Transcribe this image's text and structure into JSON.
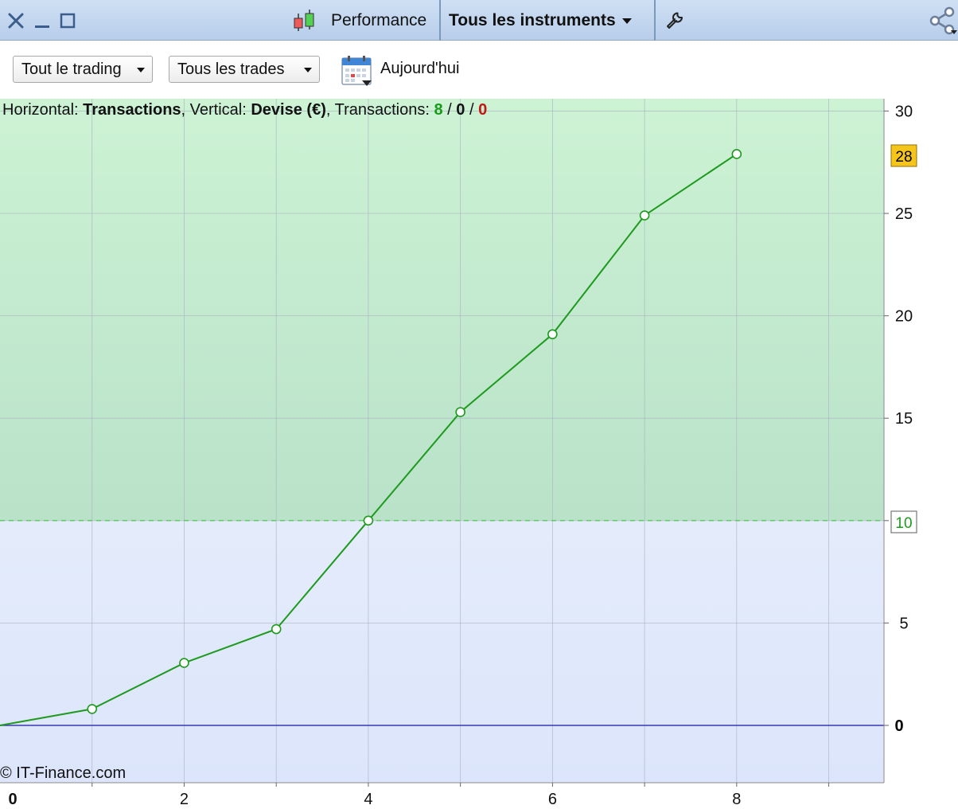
{
  "window": {
    "title": "Performance",
    "instrument_selector": "Tous les instruments"
  },
  "toolbar": {
    "trading_filter": "Tout le trading",
    "trades_filter": "Tous les trades",
    "date_label": "Aujourd'hui"
  },
  "info": {
    "horizontal_label": "Horizontal: ",
    "horizontal_value": "Transactions",
    "vertical_label": ", Vertical: ",
    "vertical_value": "Devise (€)",
    "transactions_label": ", Transactions: ",
    "count_total": "8",
    "slash": " / ",
    "count_neutral": "0",
    "count_loss": "0"
  },
  "copyright": "© IT-Finance.com",
  "colors": {
    "line": "#1e9a1e",
    "zone_above": "#c8efcf",
    "zone_below": "#e1e9fb",
    "zero_line": "#3838b4",
    "target_line": "#3ccc3c",
    "last_badge": "#f6c51a",
    "count_total": "#1a9a1a",
    "count_loss": "#c01818"
  },
  "chart_data": {
    "type": "line",
    "x": [
      0,
      1,
      2,
      3,
      4,
      5,
      6,
      7,
      8
    ],
    "y": [
      0,
      0.8,
      3.05,
      4.7,
      10.0,
      15.3,
      19.1,
      24.9,
      27.9
    ],
    "xlim": [
      0,
      9.6
    ],
    "ylim": [
      -2.8,
      30.6
    ],
    "x_ticks": [
      0,
      2,
      4,
      6,
      8
    ],
    "x_tick_labels": [
      "0",
      "2",
      "4",
      "6",
      "8"
    ],
    "y_ticks": [
      30,
      25,
      20,
      15,
      5
    ],
    "y_tick_labels": [
      "30",
      "25",
      "20",
      "15",
      "5"
    ],
    "zero_label": "0",
    "target": 10,
    "target_label": "10",
    "last_value_label": "28",
    "grid": true
  }
}
